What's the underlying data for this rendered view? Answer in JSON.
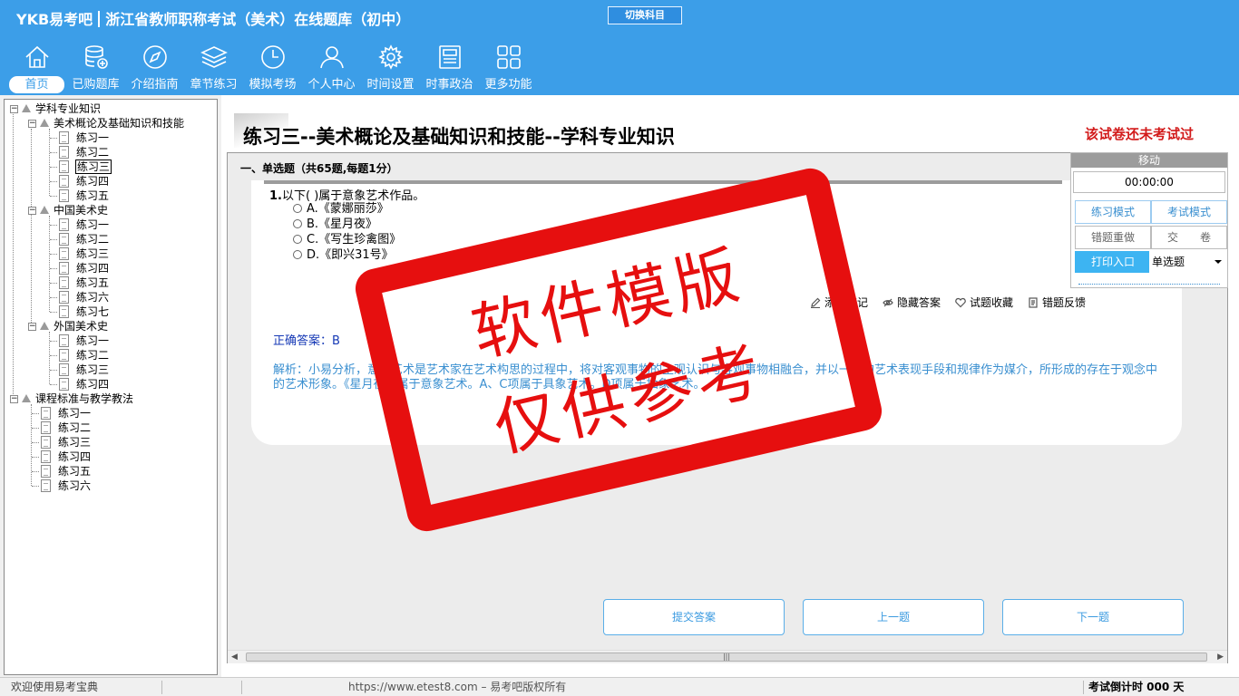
{
  "header": {
    "brand": "YKB易考吧",
    "subtitle": "浙江省教师职称考试（美术）在线题库（初中）",
    "switch_subject": "切换科目",
    "nav": [
      {
        "label": "首页",
        "icon": "home-icon",
        "active": true
      },
      {
        "label": "已购题库",
        "icon": "database-add-icon",
        "active": false
      },
      {
        "label": "介绍指南",
        "icon": "compass-icon",
        "active": false
      },
      {
        "label": "章节练习",
        "icon": "layers-icon",
        "active": false
      },
      {
        "label": "模拟考场",
        "icon": "clock-icon",
        "active": false
      },
      {
        "label": "个人中心",
        "icon": "user-icon",
        "active": false
      },
      {
        "label": "时间设置",
        "icon": "gear-icon",
        "active": false
      },
      {
        "label": "时事政治",
        "icon": "news-icon",
        "active": false
      },
      {
        "label": "更多功能",
        "icon": "grid-icon",
        "active": false
      }
    ]
  },
  "tree": {
    "root": "学科专业知识",
    "groups": [
      {
        "label": "美术概论及基础知识和技能",
        "items": [
          "练习一",
          "练习二",
          "练习三",
          "练习四",
          "练习五"
        ]
      },
      {
        "label": "中国美术史",
        "items": [
          "练习一",
          "练习二",
          "练习三",
          "练习四",
          "练习五",
          "练习六",
          "练习七"
        ]
      },
      {
        "label": "外国美术史",
        "items": [
          "练习一",
          "练习二",
          "练习三",
          "练习四"
        ]
      }
    ],
    "root2": "课程标准与教学教法",
    "root2_items": [
      "练习一",
      "练习二",
      "练习三",
      "练习四",
      "练习五",
      "练习六"
    ]
  },
  "main": {
    "title": "练习三--美术概论及基础知识和技能--学科专业知识",
    "status": "该试卷还未考试过",
    "section": "一、单选题（共65题,每题1分）",
    "question": {
      "number": "1.",
      "text": "以下( )属于意象艺术作品。",
      "options": [
        "A.《蒙娜丽莎》",
        "B.《星月夜》",
        "C.《写生珍禽图》",
        "D.《即兴31号》"
      ]
    },
    "toolbar": {
      "add_note": "添加笔记",
      "hide_answer": "隐藏答案",
      "favorite": "试题收藏",
      "feedback": "错题反馈"
    },
    "answer": "正确答案：B",
    "analysis": "解析：小易分析，意象艺术是艺术家在艺术构思的过程中，将对客观事物的主观认识与客观事物相融合，并以一定的艺术表现手段和规律作为媒介，所形成的存在于观念中的艺术形象。《星月夜》属于意象艺术。A、C项属于具象艺术。D项属于抽象艺术。",
    "buttons": {
      "submit": "提交答案",
      "prev": "上一题",
      "next": "下一题"
    }
  },
  "timer_panel": {
    "move": "移动",
    "time": "00:00:00",
    "practice_mode": "练习模式",
    "exam_mode": "考试模式",
    "redo_wrong": "错题重做",
    "submit_paper": "交　　卷",
    "print": "打印入口",
    "question_type": "单选题"
  },
  "stamp": {
    "line1": "软件模版",
    "line2": "仅供参考"
  },
  "statusbar": {
    "welcome": "欢迎使用易考宝典",
    "copyright": "https://www.etest8.com – 易考吧版权所有",
    "countdown": "考试倒计时 000 天"
  },
  "colors": {
    "header_blue": "#3c9ee8",
    "stamp_red": "#e60f0f",
    "answer_blue": "#1538b5",
    "analysis_blue": "#3a8fd0",
    "status_red": "#d21a1a"
  }
}
